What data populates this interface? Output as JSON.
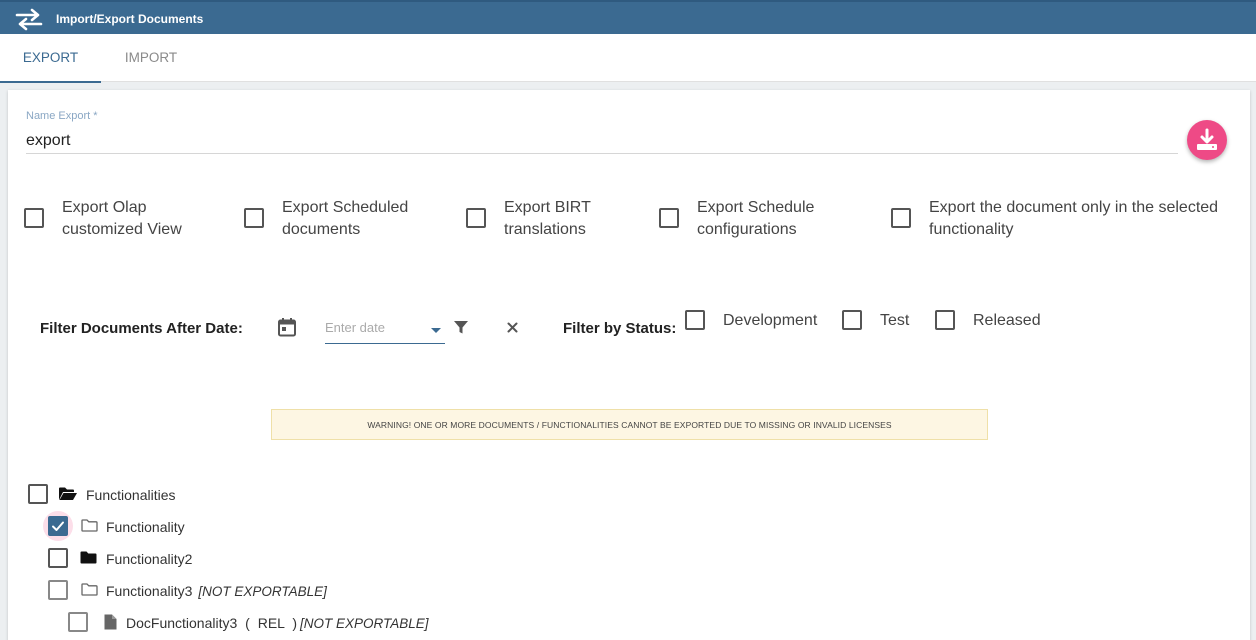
{
  "header": {
    "title": "Import/Export Documents",
    "icon": "swap-arrows-icon",
    "color": "#3b6a91"
  },
  "tabs": [
    {
      "label": "EXPORT",
      "active": true
    },
    {
      "label": "IMPORT",
      "active": false
    }
  ],
  "export_form": {
    "name_label": "Name Export *",
    "name_value": "export",
    "download_button_icon": "download-icon",
    "accent_color": "#ee4a86"
  },
  "options": [
    {
      "line1": "Export Olap",
      "line2": "customized View",
      "checked": false
    },
    {
      "line1": "Export Scheduled",
      "line2": "documents",
      "checked": false
    },
    {
      "line1": "Export BIRT",
      "line2": "translations",
      "checked": false
    },
    {
      "line1": "Export Schedule",
      "line2": "configurations",
      "checked": false
    },
    {
      "line1": "Export the document only in the selected",
      "line2": "functionality",
      "checked": false
    }
  ],
  "filter": {
    "date_label": "Filter Documents After Date:",
    "date_placeholder": "Enter date",
    "status_label": "Filter by Status:",
    "statuses": [
      {
        "label": "Development",
        "checked": false
      },
      {
        "label": "Test",
        "checked": false
      },
      {
        "label": "Released",
        "checked": false
      }
    ]
  },
  "warning": "WARNING! ONE OR MORE DOCUMENTS / FUNCTIONALITIES CANNOT BE EXPORTED DUE TO MISSING OR INVALID LICENSES",
  "tree": [
    {
      "label": "Functionalities",
      "icon": "folder-open-icon",
      "checked": false
    },
    {
      "label": "Functionality",
      "icon": "folder-outline-icon",
      "checked": true
    },
    {
      "label": "Functionality2",
      "icon": "folder-filled-icon",
      "checked": false
    },
    {
      "label": "Functionality3",
      "icon": "folder-outline-icon",
      "checked": false,
      "note": "[NOT EXPORTABLE]"
    },
    {
      "label": "DocFunctionality3",
      "status": "REL",
      "icon": "document-icon",
      "checked": false,
      "note": "[NOT EXPORTABLE]"
    }
  ]
}
